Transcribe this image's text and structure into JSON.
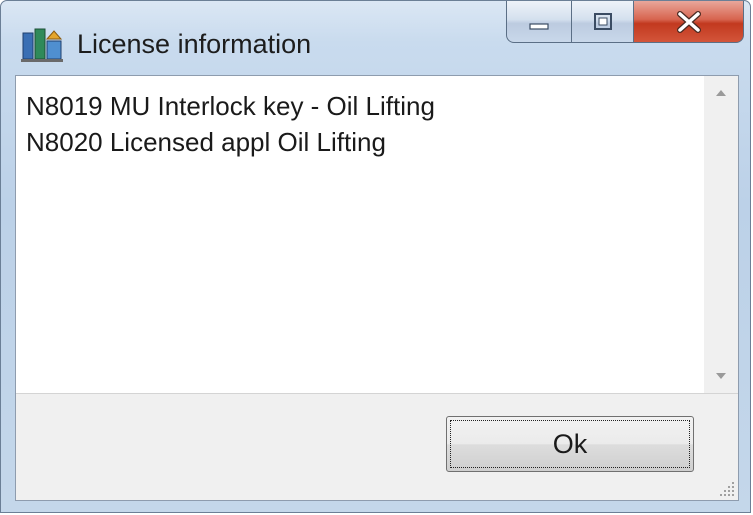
{
  "window": {
    "title": "License information",
    "icon": "license-app-icon",
    "caption_buttons": [
      "minimize-icon",
      "maximize-icon",
      "close-icon"
    ]
  },
  "license_list": {
    "items": [
      "N8019 MU Interlock key - Oil Lifting",
      "N8020 Licensed appl Oil Lifting"
    ],
    "scroll_icons": [
      "scroll-up-arrow-icon",
      "scroll-down-arrow-icon"
    ]
  },
  "buttons": {
    "ok_label": "Ok"
  },
  "colors": {
    "close_button": "#c2391f",
    "frame": "#bcd1e8",
    "client_bg": "#f0f0f0"
  }
}
